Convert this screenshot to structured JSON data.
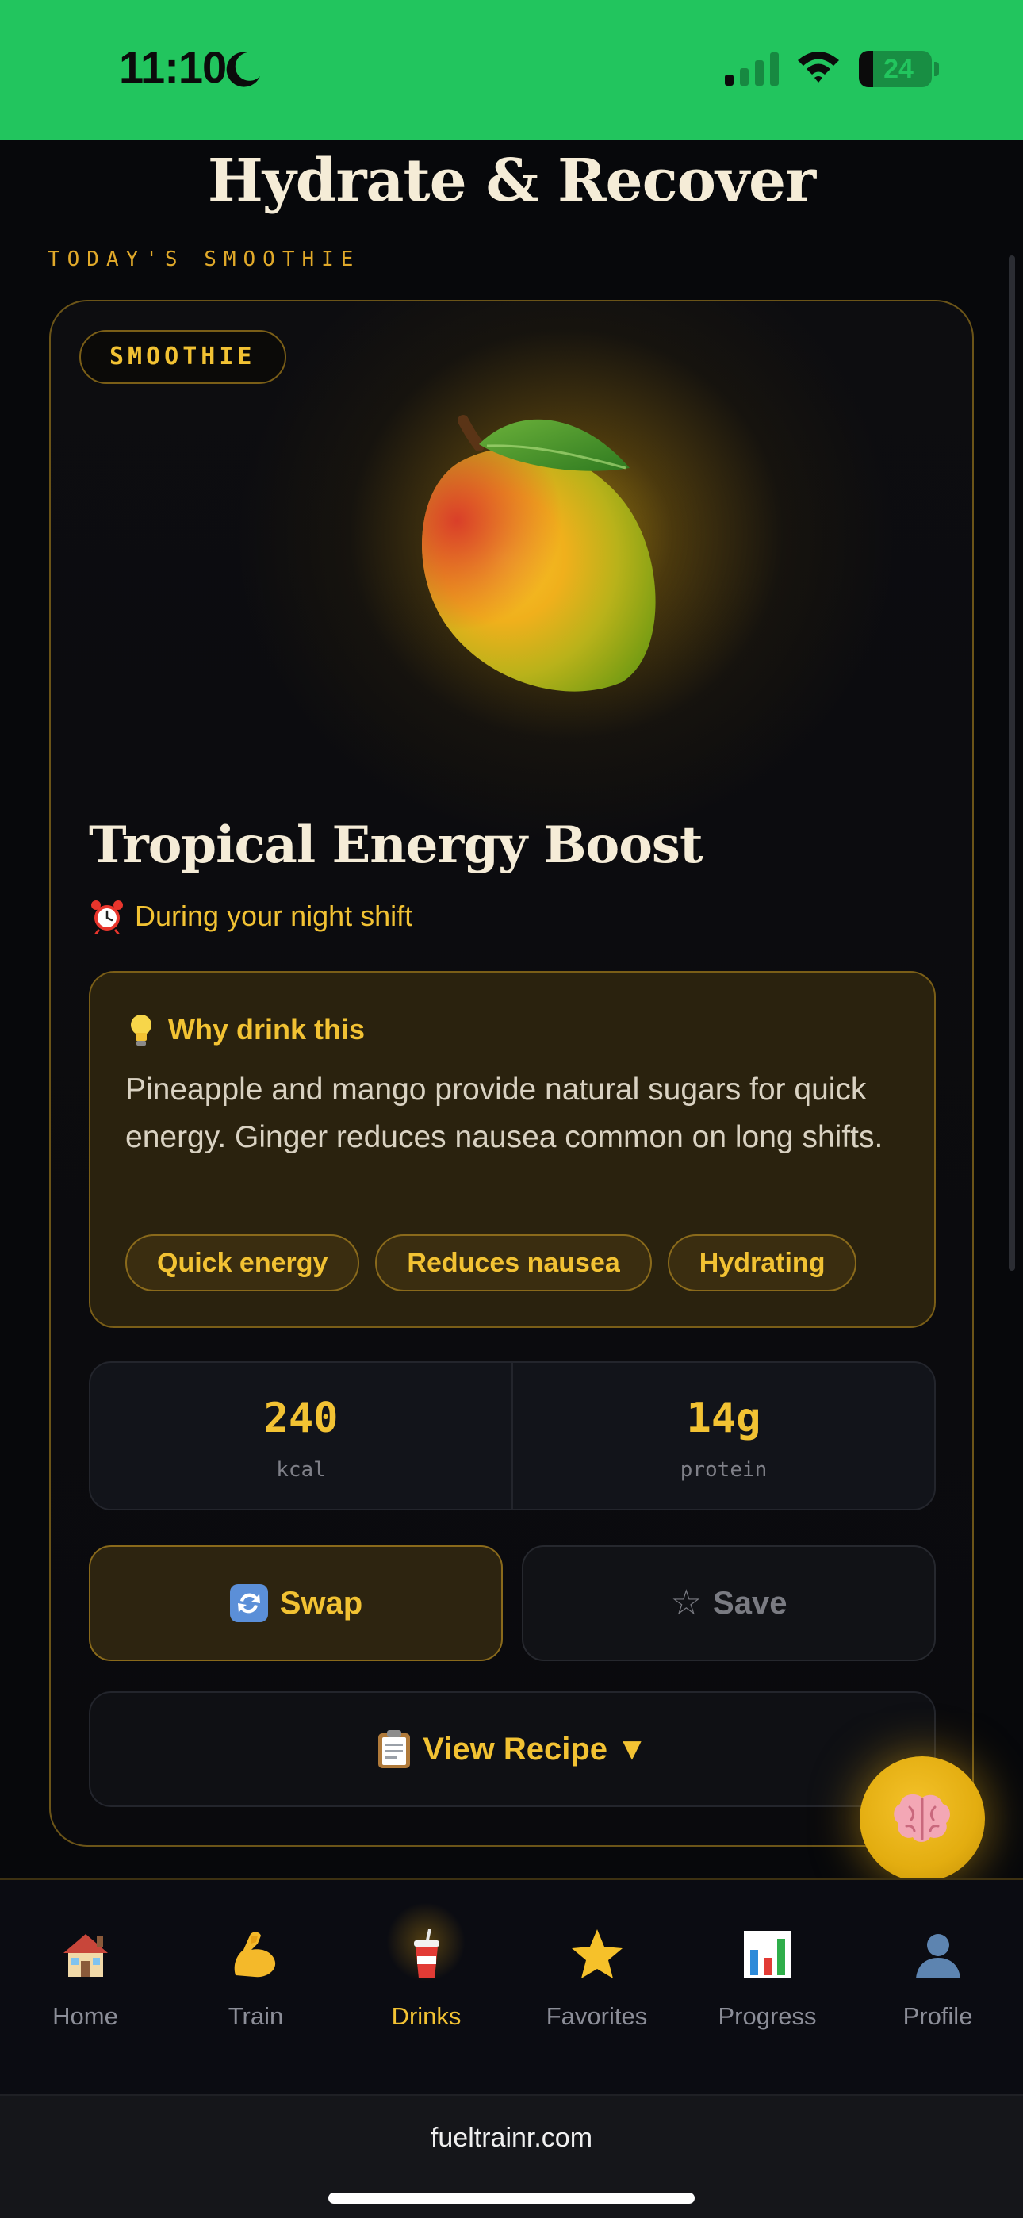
{
  "status_bar": {
    "time": "11:10",
    "battery_level": "24",
    "background_color": "#22c55e"
  },
  "header": {
    "title": "Hydrate & Recover",
    "section_label": "TODAY'S SMOOTHIE"
  },
  "drink": {
    "category": "SMOOTHIE",
    "image_icon": "mango-icon",
    "name": "Tropical Energy Boost",
    "timing_icon": "alarm-clock-icon",
    "timing": "During your night shift",
    "why": {
      "icon": "lightbulb-icon",
      "title": "Why drink this",
      "text": "Pineapple and mango provide natural sugars for quick energy. Ginger reduces nausea common on long shifts.",
      "tags": [
        "Quick energy",
        "Reduces nausea",
        "Hydrating"
      ]
    },
    "nutrition": [
      {
        "value": "240",
        "unit": "kcal"
      },
      {
        "value": "14g",
        "unit": "protein"
      }
    ]
  },
  "actions": {
    "swap_label": "Swap",
    "swap_icon": "swap-arrows-icon",
    "save_label": "Save",
    "save_icon": "star-outline-icon",
    "recipe_label": "View Recipe ▼",
    "recipe_icon": "clipboard-icon"
  },
  "fab": {
    "icon": "brain-icon"
  },
  "tabs": [
    {
      "label": "Home",
      "icon": "house-icon",
      "active": false
    },
    {
      "label": "Train",
      "icon": "flexed-biceps-icon",
      "active": false
    },
    {
      "label": "Drinks",
      "icon": "cup-with-straw-icon",
      "active": true
    },
    {
      "label": "Favorites",
      "icon": "star-icon",
      "active": false
    },
    {
      "label": "Progress",
      "icon": "bar-chart-icon",
      "active": false
    },
    {
      "label": "Profile",
      "icon": "person-silhouette-icon",
      "active": false
    }
  ],
  "browser": {
    "url": "fueltrainr.com"
  },
  "colors": {
    "accent": "#f2c233",
    "background": "#07080b",
    "card_border": "#6b5418"
  }
}
